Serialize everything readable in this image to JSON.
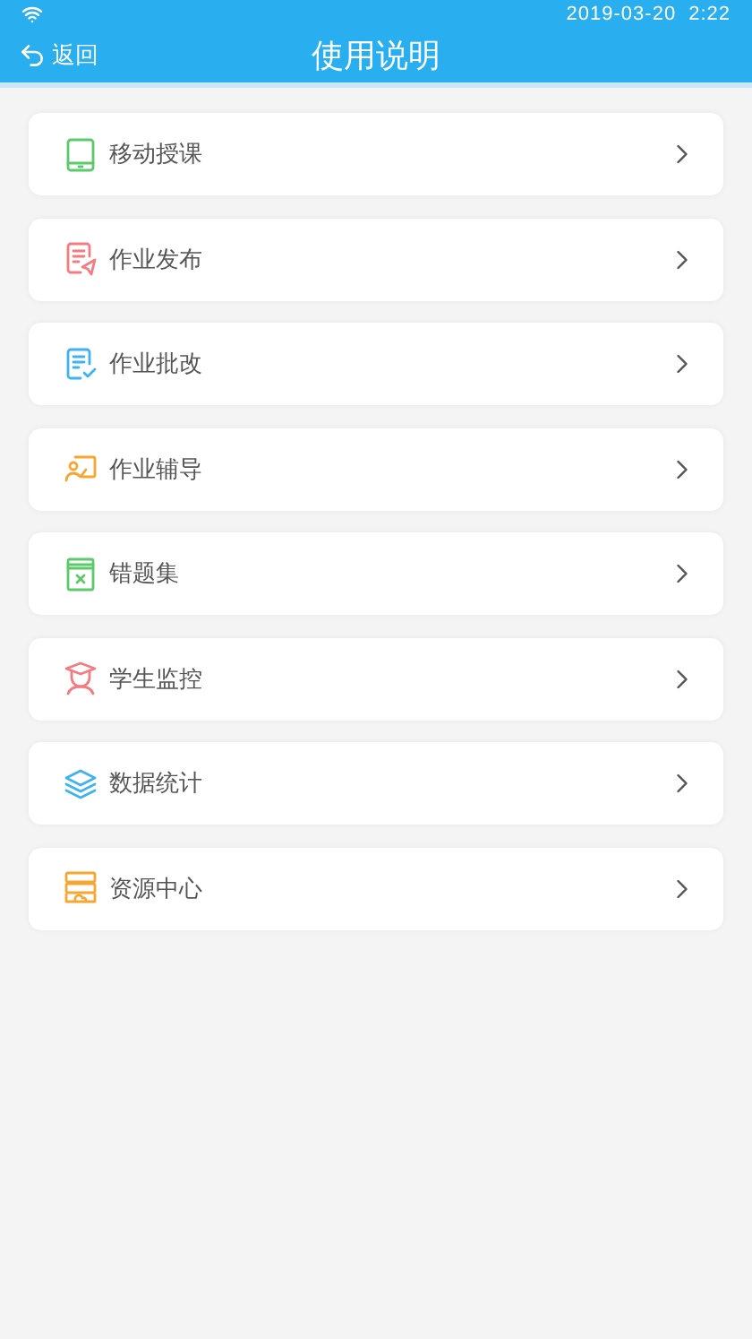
{
  "status_bar": {
    "date": "2019-03-20",
    "time": "2:22"
  },
  "header": {
    "back": "返回",
    "title": "使用说明"
  },
  "items": [
    {
      "label": "移动授课",
      "kind": "tablet",
      "color": "#5cc96a"
    },
    {
      "label": "作业发布",
      "kind": "send",
      "color": "#f47c80"
    },
    {
      "label": "作业批改",
      "kind": "check",
      "color": "#3fb2f2"
    },
    {
      "label": "作业辅导",
      "kind": "tutor",
      "color": "#f9a531"
    },
    {
      "label": "错题集",
      "kind": "book",
      "color": "#5cc96a"
    },
    {
      "label": "学生监控",
      "kind": "student",
      "color": "#f47c80"
    },
    {
      "label": "数据统计",
      "kind": "layers",
      "color": "#3fb2f2"
    },
    {
      "label": "资源中心",
      "kind": "resource",
      "color": "#f9a531"
    }
  ]
}
